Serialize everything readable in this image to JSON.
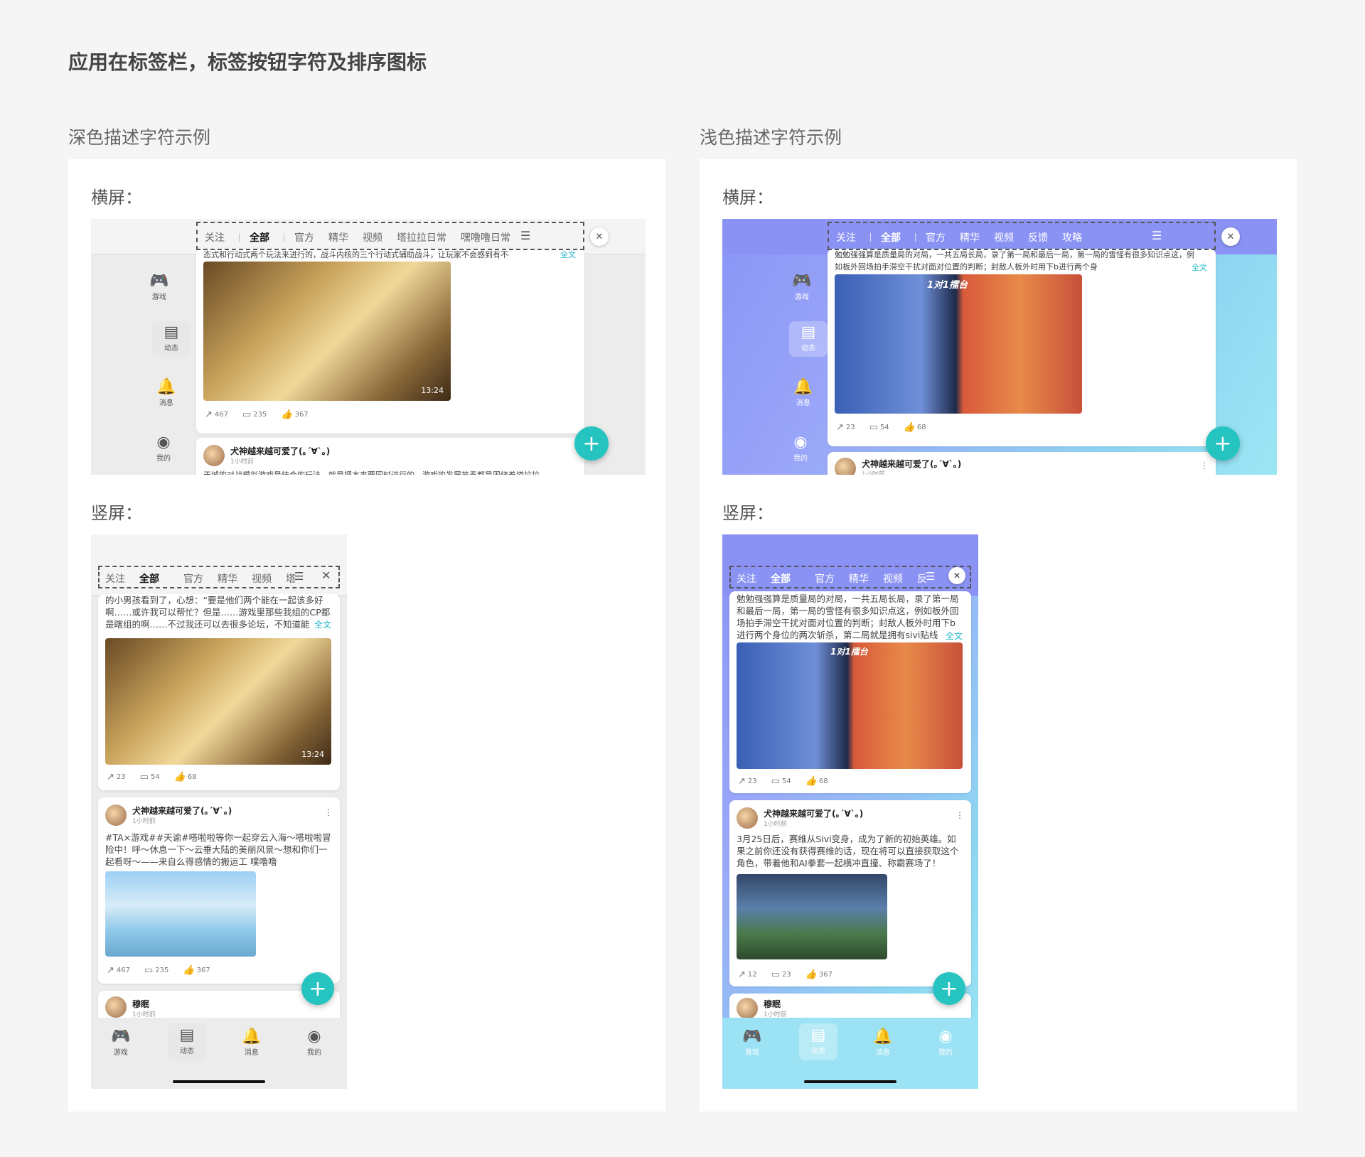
{
  "heading": "应用在标签栏，标签按钮字符及排序图标",
  "dark_section": "深色描述字符示例",
  "light_section": "浅色描述字符示例",
  "landscape_label": "横屏：",
  "portrait_label": "竖屏：",
  "tabs_dark_land": [
    "关注",
    "全部",
    "官方",
    "精华",
    "视频",
    "塔拉拉日常",
    "嘿噜噜日常"
  ],
  "tabs_dark_port": [
    "关注",
    "全部",
    "官方",
    "精华",
    "视频",
    "塔"
  ],
  "tabs_light_land": [
    "关注",
    "全部",
    "官方",
    "精华",
    "视频",
    "反馈",
    "攻略"
  ],
  "tabs_light_port": [
    "关注",
    "全部",
    "官方",
    "精华",
    "视频",
    "反"
  ],
  "sort_icon": "sort-icon",
  "close_glyph": "✕",
  "fab_glyph": "+",
  "duration": "13:24",
  "more_link": "全文",
  "nav": [
    "游戏",
    "动态",
    "消息",
    "我的"
  ],
  "dark_land": {
    "post_text": "态式和行动式两个玩法来进行的，战斗内核的三个行动式辅助战斗，让玩家不会感到有不",
    "stats": [
      "467",
      "235",
      "367"
    ],
    "user": "犬神越来越可爱了(｡´∀`｡)",
    "time": "1小时前",
    "cut_text": "天城的对战模拟游戏是结合的玩法，就是把本来要同时进行的，游戏的发展节奏都是围绕着塔拉拉"
  },
  "dark_port": {
    "post_text": "的小男孩看到了，心想：“要是他们两个能在一起该多好啊……或许我可以帮忙？但是……游戏里那些我组的CP都是瞎组的啊……不过我还可以去很多论坛，不知道能",
    "stats1": [
      "23",
      "54",
      "68"
    ],
    "user": "犬神越来越可爱了(｡´∀`｡)",
    "time": "1小时前",
    "post2": "#TA×游戏##天谕#嗒啦啦等你一起穿云入海～嗒啦啦冒险中！呼～休息一下～云垂大陆的美丽风景～想和你们一起看呀～——来自么得感情的搬运工 噗噜噜",
    "stats2": [
      "467",
      "235",
      "367"
    ],
    "user3": "穆眠",
    "time3": "1小时前"
  },
  "light_land": {
    "post_text": "勉勉强强算是质量局的对局，一共五局长局，录了第一局和最后一局，第一局的雪怪有很多知识点这，例如板外回场拍手滞空干扰对面对位置的判断；封敌人板外时用下b进行两个身",
    "banner": "1对1擂台",
    "stats": [
      "23",
      "54",
      "68"
    ],
    "user": "犬神越来越可爱了(｡´∀`｡)",
    "time": "1小时前"
  },
  "light_port": {
    "post_text": "勉勉强强算是质量局的对局，一共五局长局，录了第一局和最后一局，第一局的雪怪有很多知识点这，例如板外回场拍手滞空干扰对面对位置的判断；封敌人板外时用下b进行两个身位的两次斩杀，第二局就是拥有sivi贴线",
    "banner": "1对1擂台",
    "stats1": [
      "23",
      "54",
      "68"
    ],
    "user": "犬神越来越可爱了(｡´∀`｡)",
    "time": "1小时前",
    "post2": "3月25日后，赛维从Sivi变身，成为了新的初始英雄。如果之前你还没有获得赛维的话，现在将可以直接获取这个角色，带着他和AI拳套一起横冲直撞、称霸赛场了！",
    "stats2": [
      "12",
      "23",
      "367"
    ],
    "user3": "穆眠",
    "time3": "1小时前"
  }
}
